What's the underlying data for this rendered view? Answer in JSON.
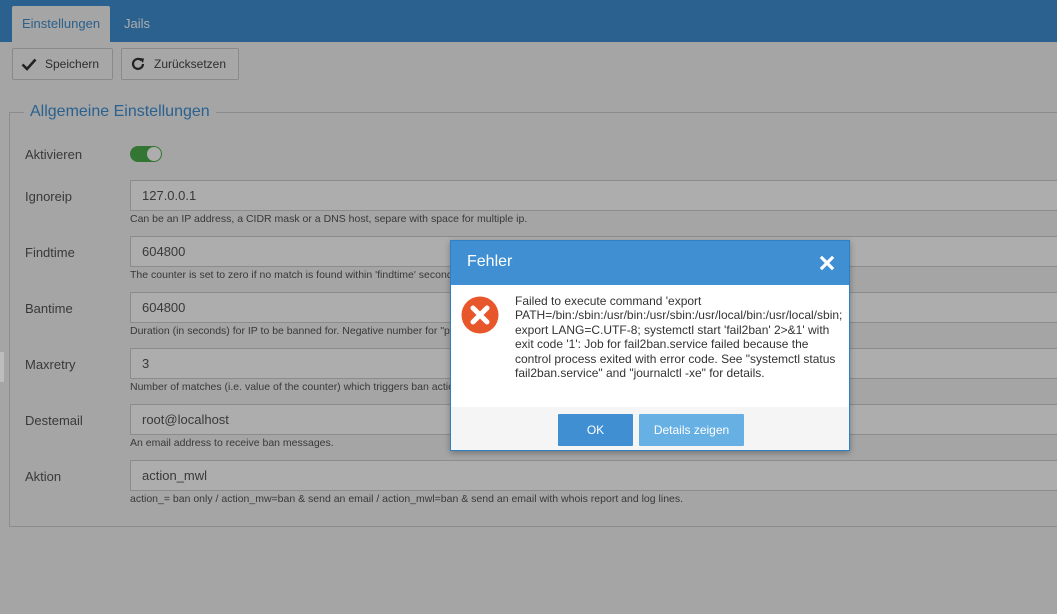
{
  "tabs": [
    {
      "label": "Einstellungen",
      "active": true
    },
    {
      "label": "Jails",
      "active": false
    }
  ],
  "toolbar": {
    "save_label": "Speichern",
    "reset_label": "Zurücksetzen"
  },
  "section": {
    "legend": "Allgemeine Einstellungen"
  },
  "settings": {
    "enable": {
      "label": "Aktivieren",
      "value": true
    },
    "ignoreip": {
      "label": "Ignoreip",
      "value": "127.0.0.1",
      "hint": "Can be an IP address, a CIDR mask or a DNS host, separe with space for multiple ip."
    },
    "findtime": {
      "label": "Findtime",
      "value": "604800",
      "hint": "The counter is set to zero if no match is found within 'findtime' seconds."
    },
    "bantime": {
      "label": "Bantime",
      "value": "604800",
      "hint": "Duration (in seconds) for IP to be banned for. Negative number for \"permanent\" ban."
    },
    "maxretry": {
      "label": "Maxretry",
      "value": "3",
      "hint": "Number of matches (i.e. value of the counter) which triggers ban action on the IP."
    },
    "destemail": {
      "label": "Destemail",
      "value": "root@localhost",
      "hint": "An email address to receive ban messages."
    },
    "action": {
      "label": "Aktion",
      "value": "action_mwl",
      "hint": "action_= ban only / action_mw=ban & send an email / action_mwl=ban & send an email with whois report and log lines."
    }
  },
  "dialog": {
    "title": "Fehler",
    "message": "Failed to execute command 'export PATH=/bin:/sbin:/usr/bin:/usr/sbin:/usr/local/bin:/usr/local/sbin; export LANG=C.UTF-8; systemctl start 'fail2ban' 2>&1' with exit code '1': Job for fail2ban.service failed because the control process exited with error code. See \"systemctl status fail2ban.service\" and \"journalctl -xe\" for details.",
    "ok_label": "OK",
    "details_label": "Details zeigen"
  },
  "colors": {
    "accent": "#3f8fd2",
    "error": "#e8572b",
    "toggle_on": "#4cae4c"
  },
  "icons": {
    "save": "check-icon",
    "reset": "refresh-icon",
    "close": "close-icon",
    "error": "error-x-circle-icon"
  }
}
